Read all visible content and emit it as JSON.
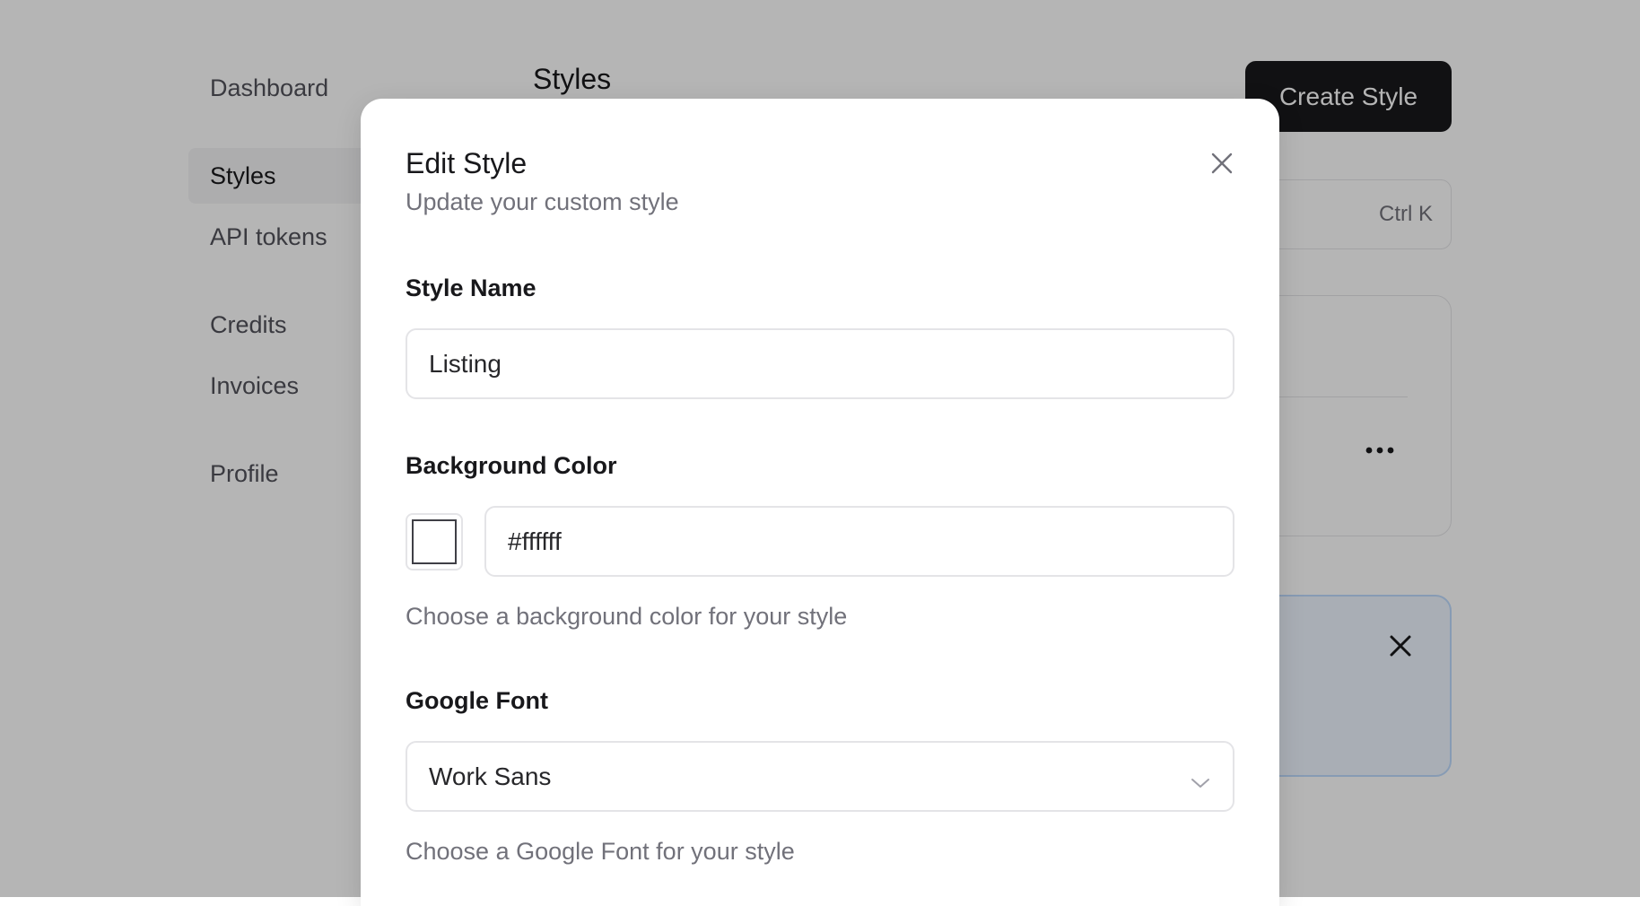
{
  "sidebar": {
    "items": [
      {
        "label": "Dashboard"
      },
      {
        "label": "Styles",
        "active": true
      },
      {
        "label": "API tokens"
      },
      {
        "label": "Credits"
      },
      {
        "label": "Invoices"
      },
      {
        "label": "Profile"
      }
    ]
  },
  "header": {
    "title": "Styles",
    "create_label": "Create Style"
  },
  "search": {
    "shortcut": "Ctrl K"
  },
  "modal": {
    "title": "Edit Style",
    "subtitle": "Update your custom style",
    "style_name": {
      "label": "Style Name",
      "value": "Listing"
    },
    "background_color": {
      "label": "Background Color",
      "value": "#ffffff",
      "help": "Choose a background color for your style"
    },
    "google_font": {
      "label": "Google Font",
      "selected": "Work Sans",
      "help": "Choose a Google Font for your style"
    }
  },
  "icons": {
    "close": "close-icon",
    "more": "more-icon",
    "chevron": "chevron-down-icon"
  },
  "colors": {
    "primary": "#18181b",
    "overlay": "#000000",
    "notice_bg": "#eff6ff",
    "notice_border": "#bfdbfe"
  }
}
